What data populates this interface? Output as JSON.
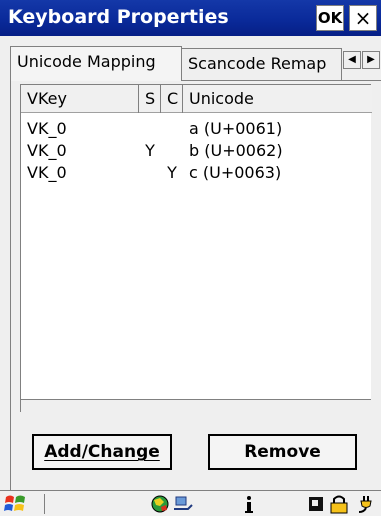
{
  "window": {
    "title": "Keyboard Properties",
    "ok_label": "OK",
    "close_label": "×"
  },
  "tabs": [
    {
      "label": "Unicode Mapping",
      "active": true
    },
    {
      "label": "Scancode Remap",
      "active": false
    }
  ],
  "list": {
    "columns": [
      "VKey",
      "S",
      "C",
      "Unicode"
    ],
    "rows": [
      {
        "vkey": "VK_0",
        "s": "",
        "c": "",
        "unicode": "a (U+0061)"
      },
      {
        "vkey": "VK_0",
        "s": "Y",
        "c": "",
        "unicode": "b (U+0062)"
      },
      {
        "vkey": "VK_0",
        "s": "",
        "c": "Y",
        "unicode": "c (U+0063)"
      }
    ]
  },
  "buttons": {
    "add_change": "Add/Change",
    "remove": "Remove"
  },
  "taskbar": {
    "icons": [
      "windows-start-icon",
      "globe-icon",
      "network-icon",
      "info-icon",
      "card-icon",
      "lock-icon",
      "power-plug-icon"
    ]
  },
  "colors": {
    "titlebar": "#0a2a9a",
    "window_bg": "#efefef",
    "list_bg": "#ffffff"
  }
}
